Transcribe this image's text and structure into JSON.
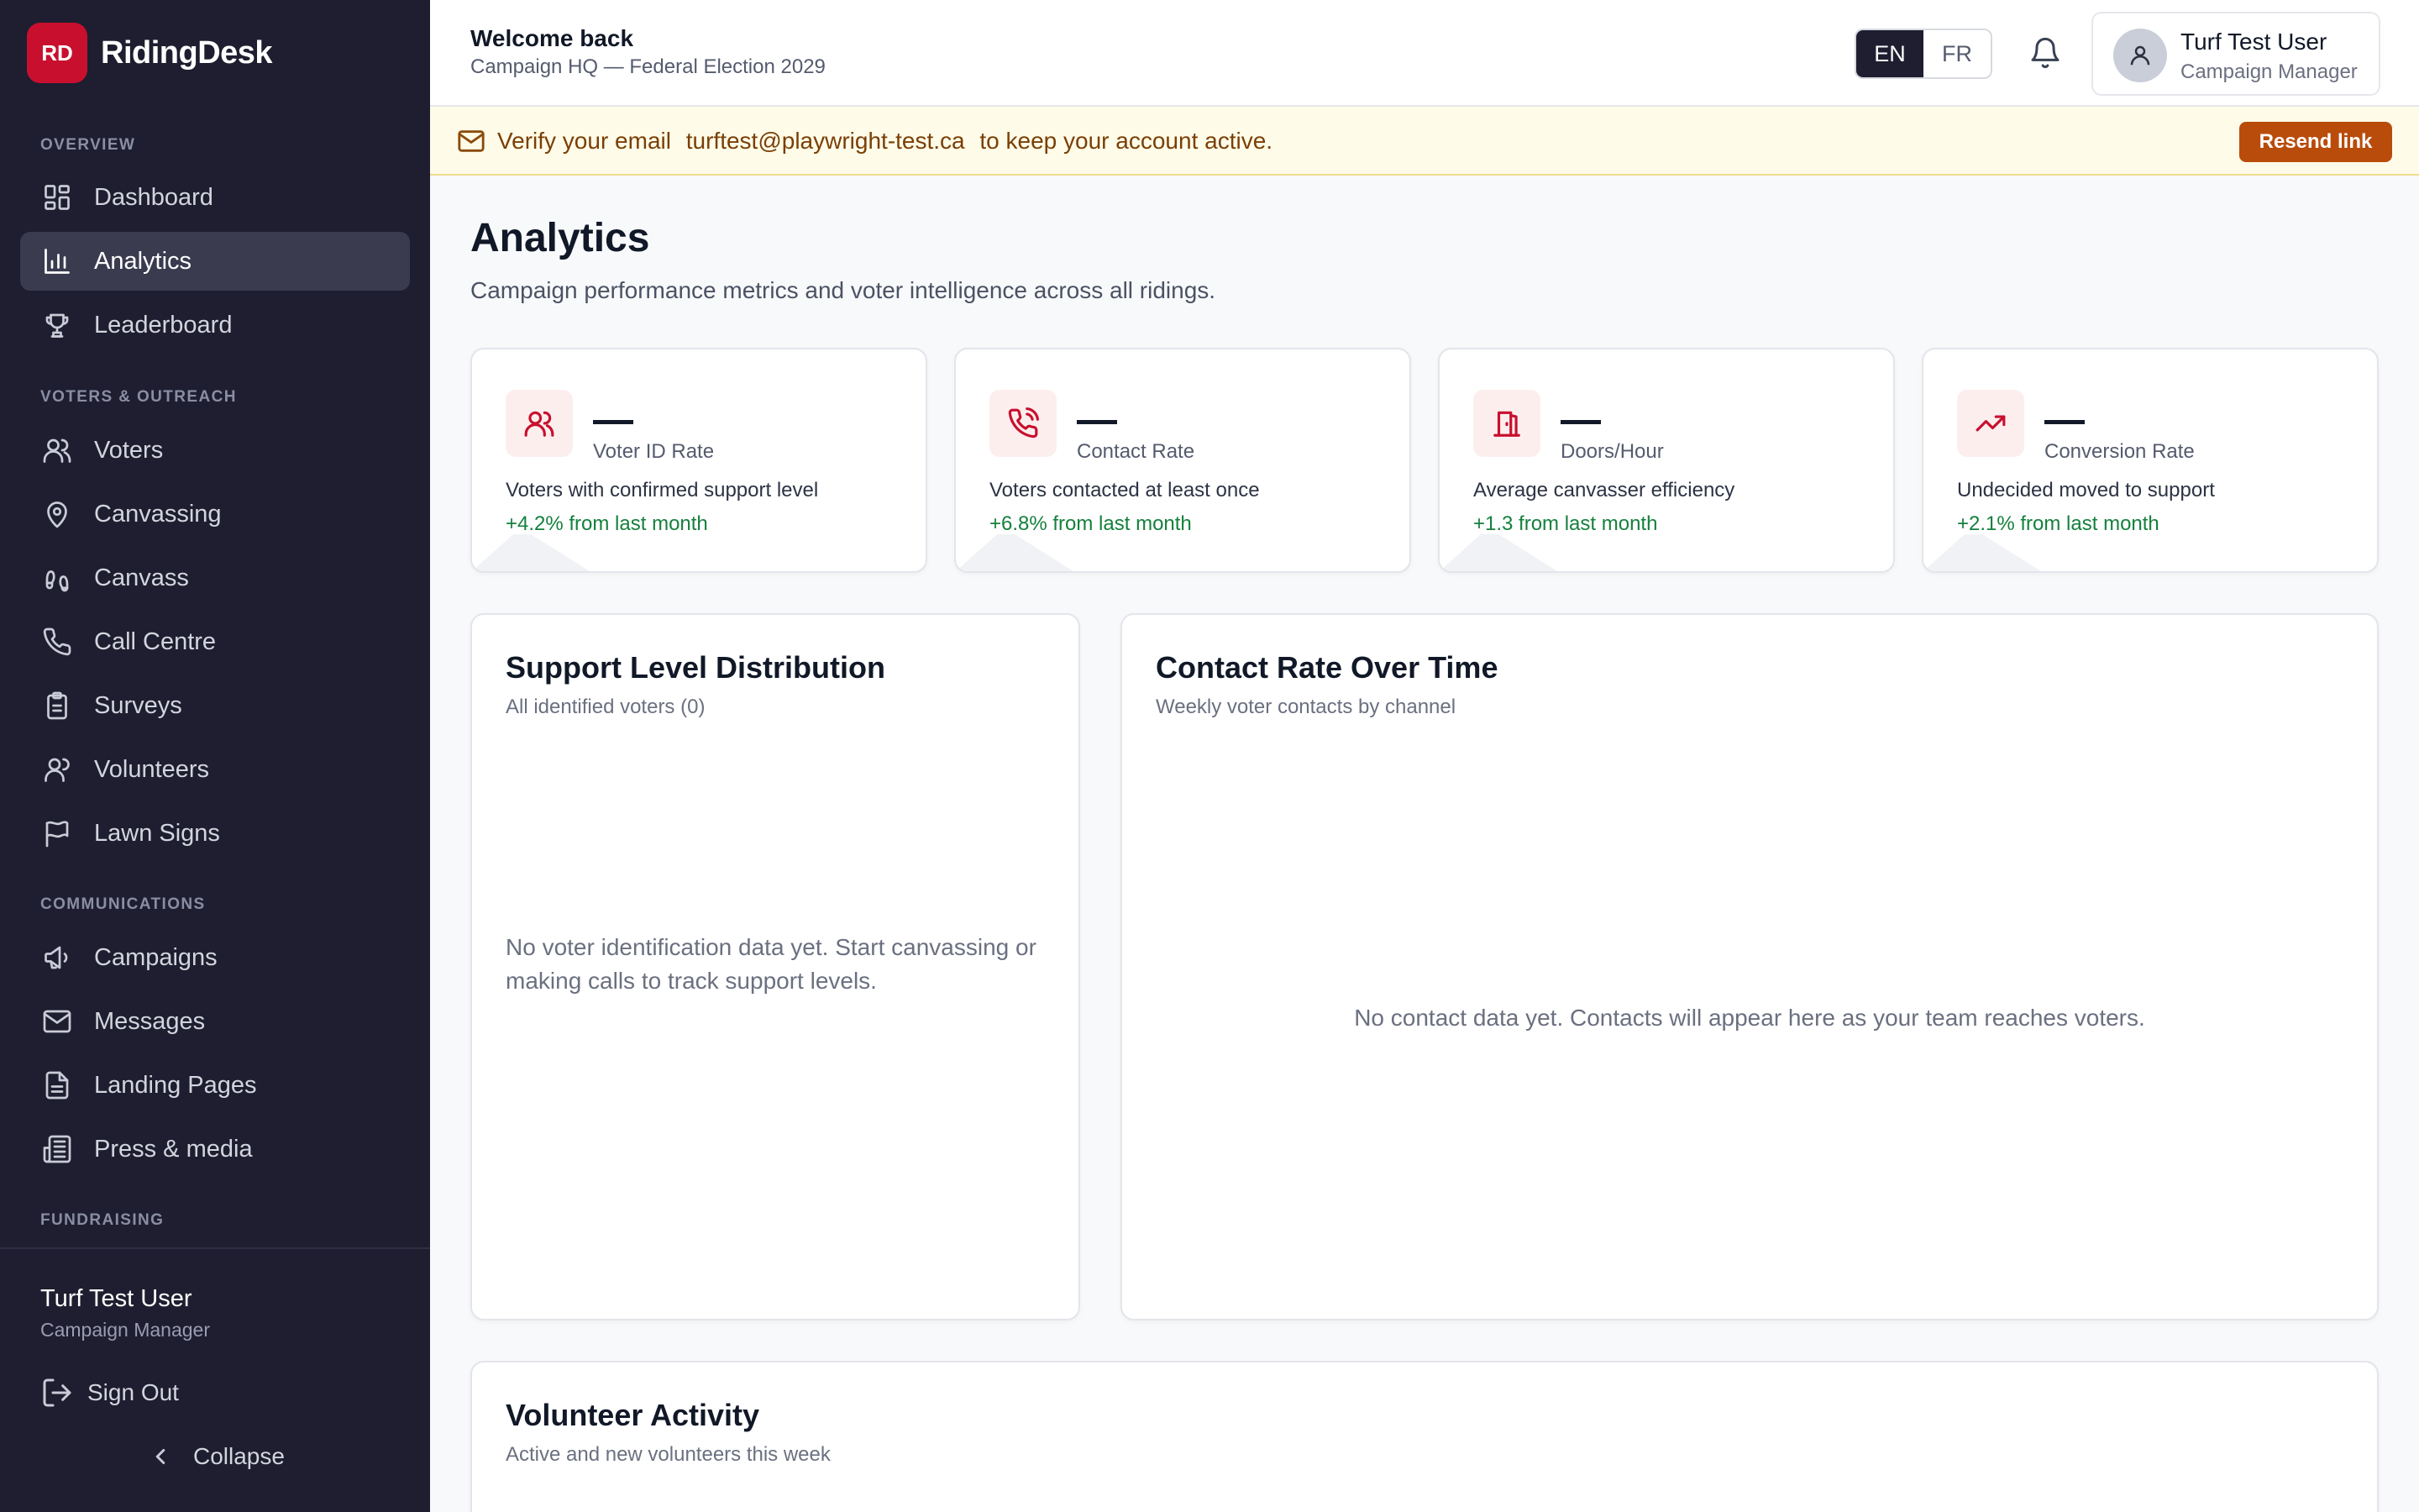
{
  "brand": {
    "badge": "RD",
    "name": "RidingDesk"
  },
  "sidebar": {
    "sections": {
      "overview": "OVERVIEW",
      "voters": "VOTERS & OUTREACH",
      "communications": "COMMUNICATIONS",
      "fundraising": "FUNDRAISING"
    },
    "items": [
      {
        "label": "Dashboard",
        "icon": "dashboard-icon"
      },
      {
        "label": "Analytics",
        "icon": "bar-chart-icon",
        "active": true
      },
      {
        "label": "Leaderboard",
        "icon": "trophy-icon"
      },
      {
        "label": "Voters",
        "icon": "users-icon"
      },
      {
        "label": "Canvassing",
        "icon": "map-pin-icon"
      },
      {
        "label": "Canvass",
        "icon": "footprints-icon"
      },
      {
        "label": "Call Centre",
        "icon": "phone-icon"
      },
      {
        "label": "Surveys",
        "icon": "clipboard-icon"
      },
      {
        "label": "Volunteers",
        "icon": "user-group-icon"
      },
      {
        "label": "Lawn Signs",
        "icon": "flag-icon"
      },
      {
        "label": "Campaigns",
        "icon": "megaphone-icon"
      },
      {
        "label": "Messages",
        "icon": "mail-icon"
      },
      {
        "label": "Landing Pages",
        "icon": "file-icon"
      },
      {
        "label": "Press & media",
        "icon": "newspaper-icon"
      }
    ],
    "user": {
      "name": "Turf Test User",
      "role": "Campaign Manager"
    },
    "sign_out": "Sign Out",
    "collapse": "Collapse"
  },
  "header": {
    "welcome": "Welcome back",
    "campaign": "Campaign HQ — Federal Election 2029",
    "lang": {
      "en": "EN",
      "fr": "FR",
      "active": "EN"
    },
    "user": {
      "name": "Turf Test User",
      "role": "Campaign Manager"
    }
  },
  "banner": {
    "prefix": "Verify your email",
    "email": "turftest@playwright-test.ca",
    "suffix": "to keep your account active.",
    "button": "Resend link"
  },
  "page": {
    "title": "Analytics",
    "subtitle": "Campaign performance metrics and voter intelligence across all ridings."
  },
  "metrics": [
    {
      "value": "—",
      "label": "Voter ID Rate",
      "description": "Voters with confirmed support level",
      "change": "+4.2% from last month",
      "icon": "users-icon"
    },
    {
      "value": "—",
      "label": "Contact Rate",
      "description": "Voters contacted at least once",
      "change": "+6.8% from last month",
      "icon": "phone-call-icon"
    },
    {
      "value": "—",
      "label": "Doors/Hour",
      "description": "Average canvasser efficiency",
      "change": "+1.3 from last month",
      "icon": "door-icon"
    },
    {
      "value": "—",
      "label": "Conversion Rate",
      "description": "Undecided moved to support",
      "change": "+2.1% from last month",
      "icon": "trending-up-icon"
    }
  ],
  "panels": {
    "support": {
      "title": "Support Level Distribution",
      "subtitle": "All identified voters (0)",
      "empty": "No voter identification data yet. Start canvassing or making calls to track support levels."
    },
    "contact": {
      "title": "Contact Rate Over Time",
      "subtitle": "Weekly voter contacts by channel",
      "empty": "No contact data yet. Contacts will appear here as your team reaches voters."
    },
    "volunteer": {
      "title": "Volunteer Activity",
      "subtitle": "Active and new volunteers this week"
    }
  },
  "colors": {
    "accent": "#c8102e",
    "sidebar": "#1e1e30",
    "positive": "#15803d",
    "banner_button": "#b94c0b"
  }
}
